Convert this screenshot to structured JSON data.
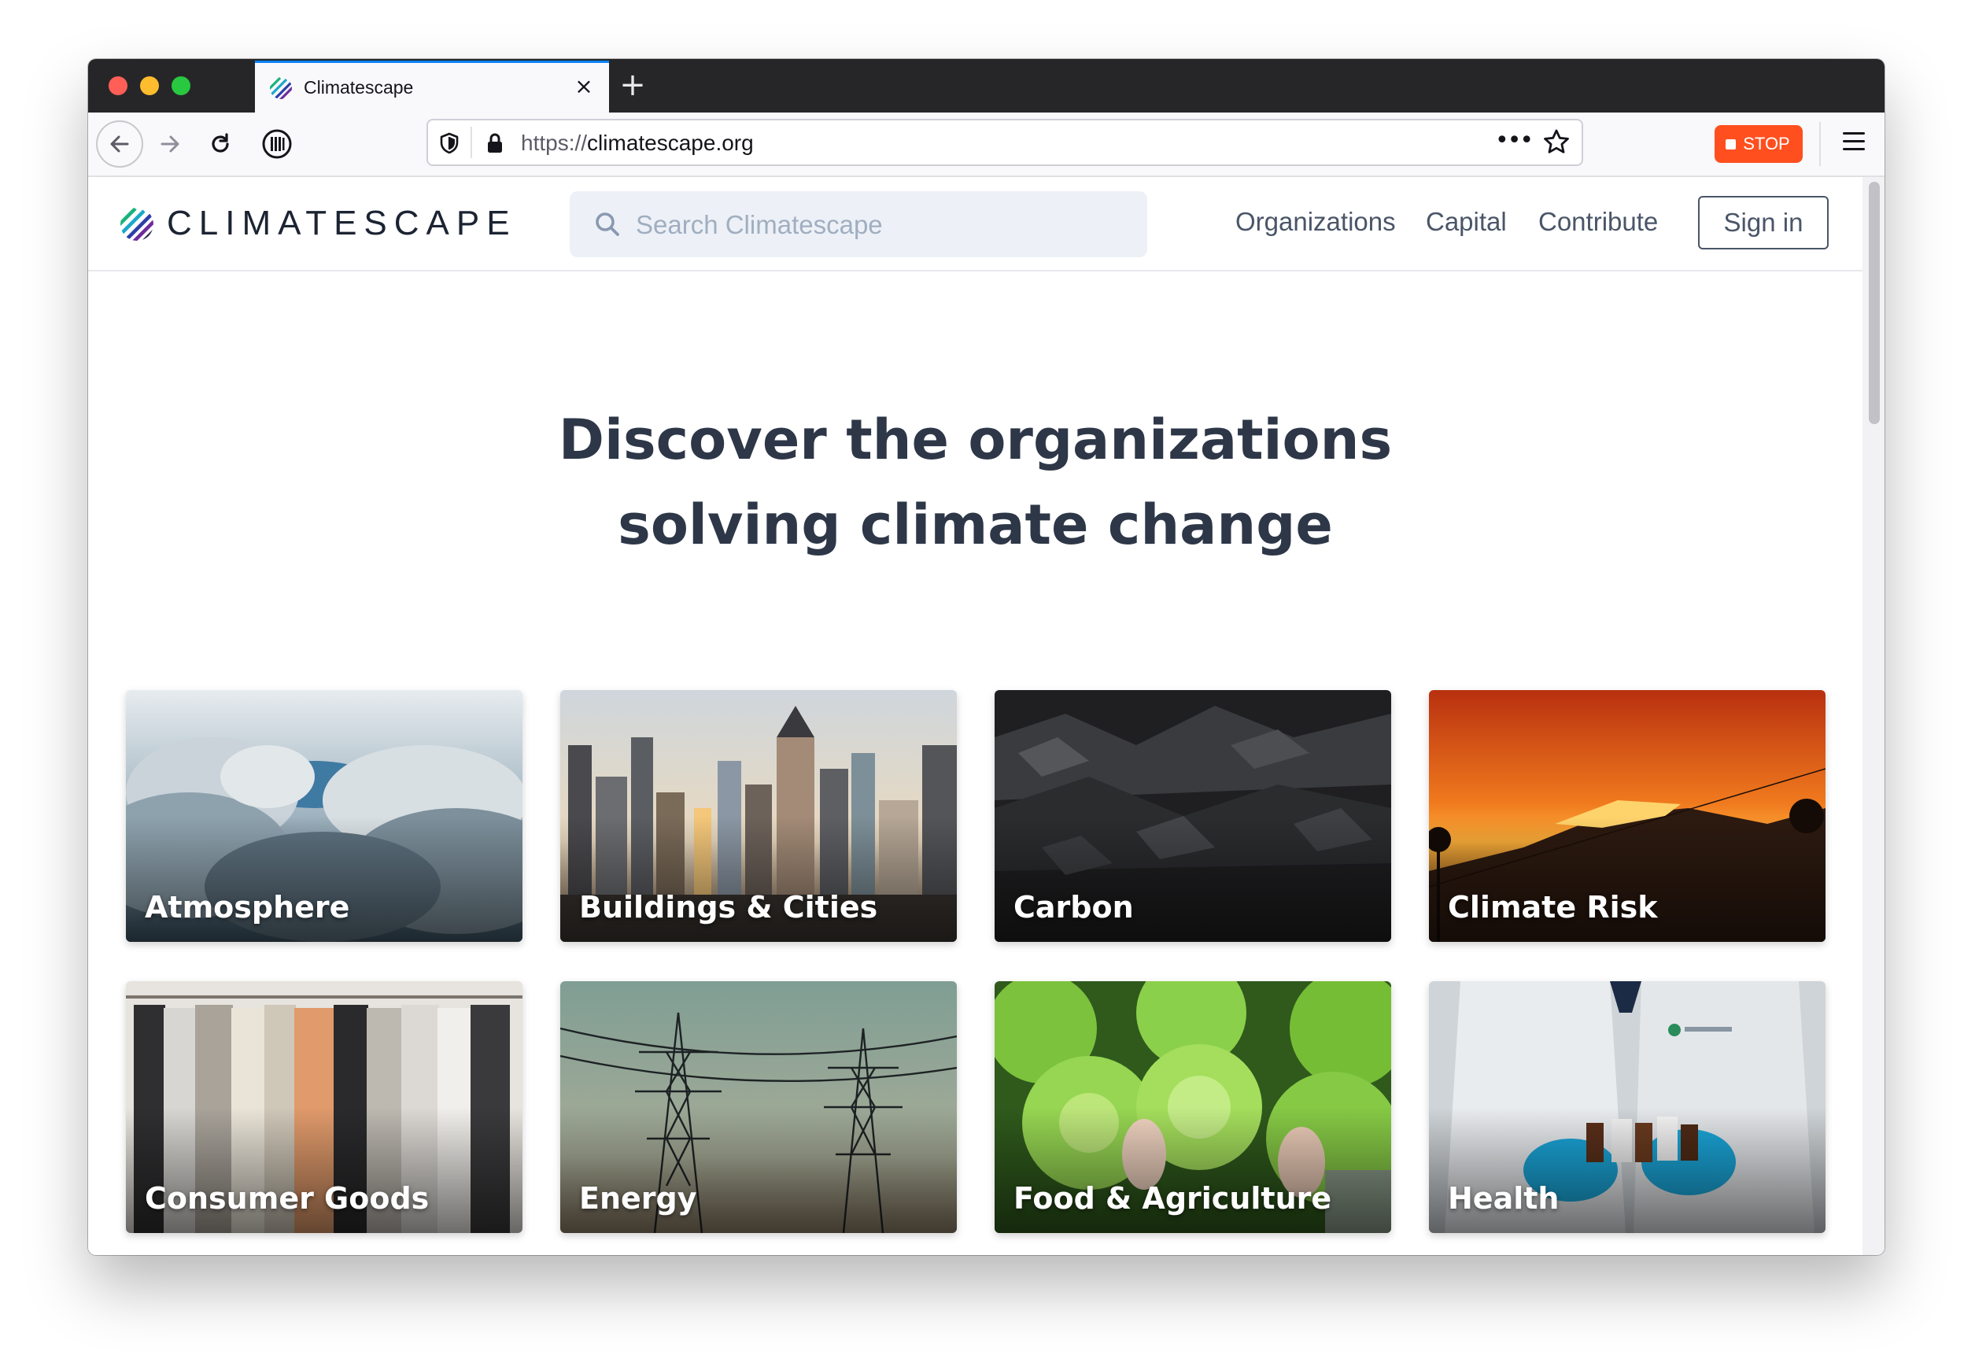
{
  "browser": {
    "tab_title": "Climatescape",
    "tab_close": "×",
    "new_tab": "+",
    "url_scheme": "https://",
    "url_host": "climatescape.org",
    "url_more": "•••",
    "stop_label": "STOP"
  },
  "site": {
    "logo_text": "CLIMATESCAPE",
    "search_placeholder": "Search Climatescape",
    "nav": [
      "Organizations",
      "Capital",
      "Contribute"
    ],
    "signin_label": "Sign in",
    "hero_line1": "Discover the organizations",
    "hero_line2": "solving climate change"
  },
  "categories": [
    {
      "label": "Atmosphere",
      "image": "clouds-photo"
    },
    {
      "label": "Buildings & Cities",
      "image": "city-skyline-photo"
    },
    {
      "label": "Carbon",
      "image": "coal-photo"
    },
    {
      "label": "Climate Risk",
      "image": "wildfire-photo"
    },
    {
      "label": "Consumer Goods",
      "image": "clothing-rack-photo"
    },
    {
      "label": "Energy",
      "image": "power-lines-photo"
    },
    {
      "label": "Food & Agriculture",
      "image": "lettuce-photo"
    },
    {
      "label": "Health",
      "image": "lab-coat-photo"
    }
  ],
  "colors": {
    "accent_tab": "#0a84ff",
    "stop_button": "#ff4f1f",
    "heading": "#2d3748",
    "nav_text": "#4a5568",
    "search_bg": "#edf1f7"
  }
}
